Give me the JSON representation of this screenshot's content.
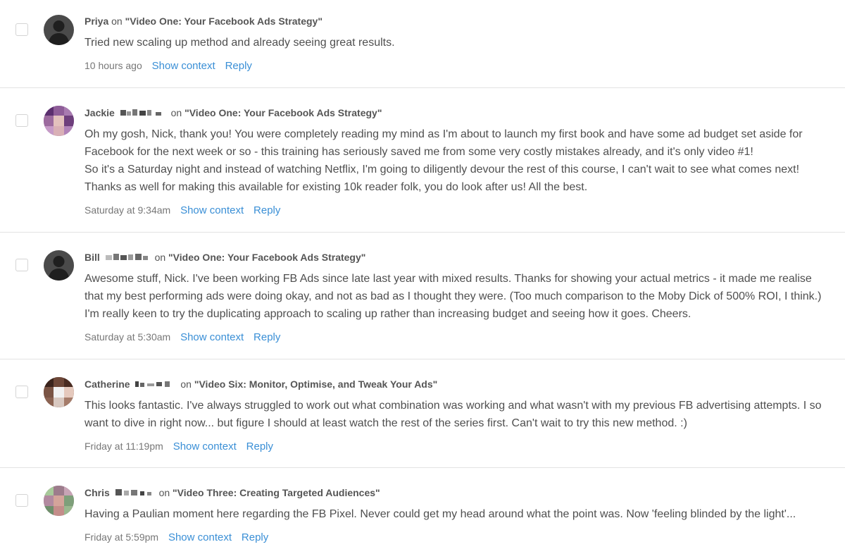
{
  "comments": [
    {
      "author": "Priya",
      "on": "on",
      "post": "\"Video One: Your Facebook Ads Strategy\"",
      "body": [
        "Tried new scaling up method and already seeing great results."
      ],
      "time": "10 hours ago",
      "show_context": "Show context",
      "reply": "Reply",
      "avatar": "default-avatar-icon"
    },
    {
      "author": "Jackie",
      "on": "on",
      "post": "\"Video One: Your Facebook Ads Strategy\"",
      "body": [
        "Oh my gosh, Nick, thank you! You were completely reading my mind as I'm about to launch my first book and have some ad budget set aside for Facebook for the next week or so - this training has seriously saved me from some very costly mistakes already, and it's only video #1!",
        "So it's a Saturday night and instead of watching Netflix, I'm going to diligently devour the rest of this course, I can't wait to see what comes next! Thanks as well for making this available for existing 10k reader folk, you do look after us! All the best."
      ],
      "time": "Saturday at 9:34am",
      "show_context": "Show context",
      "reply": "Reply",
      "avatar": "photo-avatar"
    },
    {
      "author": "Bill",
      "on": "on",
      "post": "\"Video One: Your Facebook Ads Strategy\"",
      "body": [
        "Awesome stuff, Nick. I've been working FB Ads since late last year with mixed results. Thanks for showing your actual metrics - it made me realise that my best performing ads were doing okay, and not as bad as I thought they were. (Too much comparison to the Moby Dick of 500% ROI, I think.) I'm really keen to try the duplicating approach to scaling up rather than increasing budget and seeing how it goes. Cheers."
      ],
      "time": "Saturday at 5:30am",
      "show_context": "Show context",
      "reply": "Reply",
      "avatar": "default-avatar-icon"
    },
    {
      "author": "Catherine",
      "on": "on",
      "post": "\"Video Six: Monitor, Optimise, and Tweak Your Ads\"",
      "body": [
        "This looks fantastic. I've always struggled to work out what combination was working and what wasn't with my previous FB advertising attempts. I so want to dive in right now... but figure I should at least watch the rest of the series first. Can't wait to try this new method. :)"
      ],
      "time": "Friday at 11:19pm",
      "show_context": "Show context",
      "reply": "Reply",
      "avatar": "photo-avatar"
    },
    {
      "author": "Chris",
      "on": "on",
      "post": "\"Video Three: Creating Targeted Audiences\"",
      "body": [
        "Having a Paulian moment here regarding the FB Pixel. Never could get my head around what the point was. Now 'feeling blinded by the light'..."
      ],
      "time": "Friday at 5:59pm",
      "show_context": "Show context",
      "reply": "Reply",
      "avatar": "photo-avatar"
    }
  ],
  "colors": {
    "link": "#3a8fd6",
    "divider": "#e3e3e3",
    "text": "#4f4f4f"
  }
}
